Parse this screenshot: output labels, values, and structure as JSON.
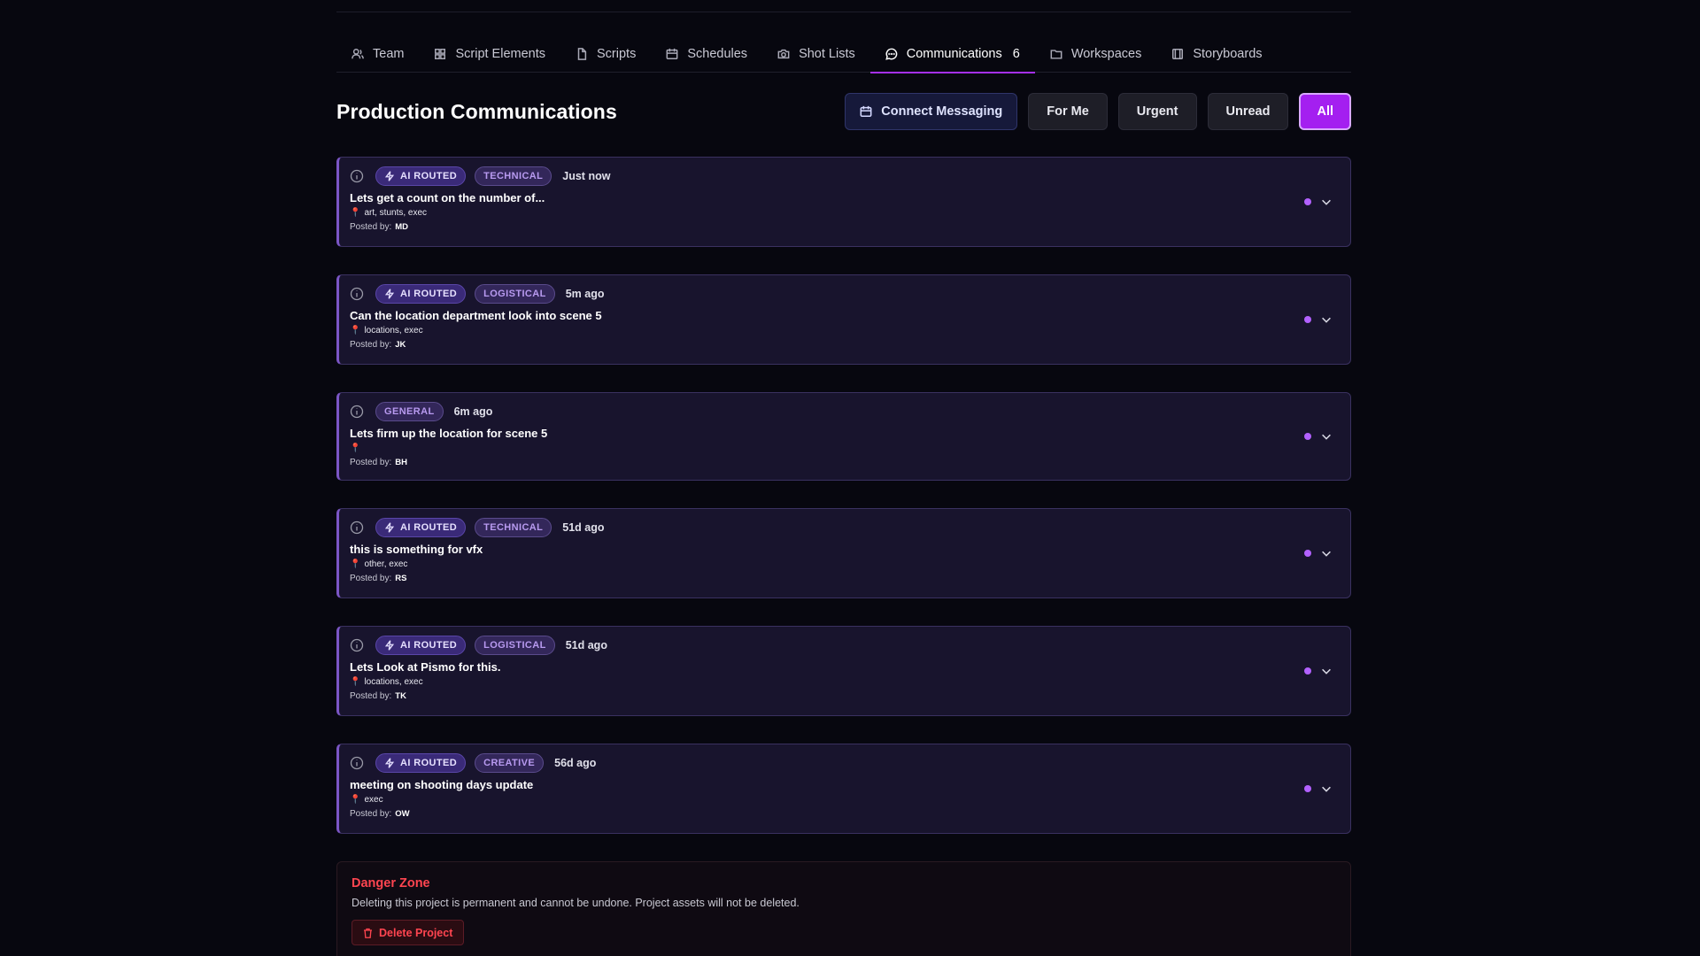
{
  "tabs": [
    {
      "label": "Team",
      "icon": "team-icon"
    },
    {
      "label": "Script Elements",
      "icon": "grid-icon"
    },
    {
      "label": "Scripts",
      "icon": "file-icon"
    },
    {
      "label": "Schedules",
      "icon": "calendar-icon"
    },
    {
      "label": "Shot Lists",
      "icon": "camera-icon"
    },
    {
      "label": "Communications",
      "icon": "chat-icon",
      "count": "6",
      "active": true
    },
    {
      "label": "Workspaces",
      "icon": "folder-icon"
    },
    {
      "label": "Storyboards",
      "icon": "film-icon"
    }
  ],
  "header": {
    "title": "Production Communications",
    "connect_label": "Connect Messaging",
    "filters": {
      "for_me": "For Me",
      "urgent": "Urgent",
      "unread": "Unread",
      "all": "All"
    },
    "active_filter": "All"
  },
  "messages": [
    {
      "ai_label": "AI ROUTED",
      "category": "TECHNICAL",
      "time": "Just now",
      "title": "Lets get a count on the number of...",
      "departments": "art, stunts, exec",
      "posted_by_label": "Posted by:",
      "author": "MD"
    },
    {
      "ai_label": "AI ROUTED",
      "category": "LOGISTICAL",
      "time": "5m ago",
      "title": "Can the location department look into scene 5",
      "departments": "locations, exec",
      "posted_by_label": "Posted by:",
      "author": "JK"
    },
    {
      "ai_label": "",
      "category": "GENERAL",
      "time": "6m ago",
      "title": "Lets firm up the location for scene 5",
      "departments": "",
      "posted_by_label": "Posted by:",
      "author": "BH"
    },
    {
      "ai_label": "AI ROUTED",
      "category": "TECHNICAL",
      "time": "51d ago",
      "title": "this is something for vfx",
      "departments": "other, exec",
      "posted_by_label": "Posted by:",
      "author": "RS"
    },
    {
      "ai_label": "AI ROUTED",
      "category": "LOGISTICAL",
      "time": "51d ago",
      "title": "Lets Look at Pismo for this.",
      "departments": "locations, exec",
      "posted_by_label": "Posted by:",
      "author": "TK"
    },
    {
      "ai_label": "AI ROUTED",
      "category": "CREATIVE",
      "time": "56d ago",
      "title": "meeting on shooting days update",
      "departments": "exec",
      "posted_by_label": "Posted by:",
      "author": "OW"
    }
  ],
  "danger_zone": {
    "title": "Danger Zone",
    "description": "Deleting this project is permanent and cannot be undone. Project assets will not be deleted.",
    "delete_label": "Delete Project"
  },
  "colors": {
    "accent": "#a41ff0",
    "background": "#07070f",
    "card": "#18142d",
    "danger": "#ff4550",
    "unread_dot": "#b261ff"
  }
}
